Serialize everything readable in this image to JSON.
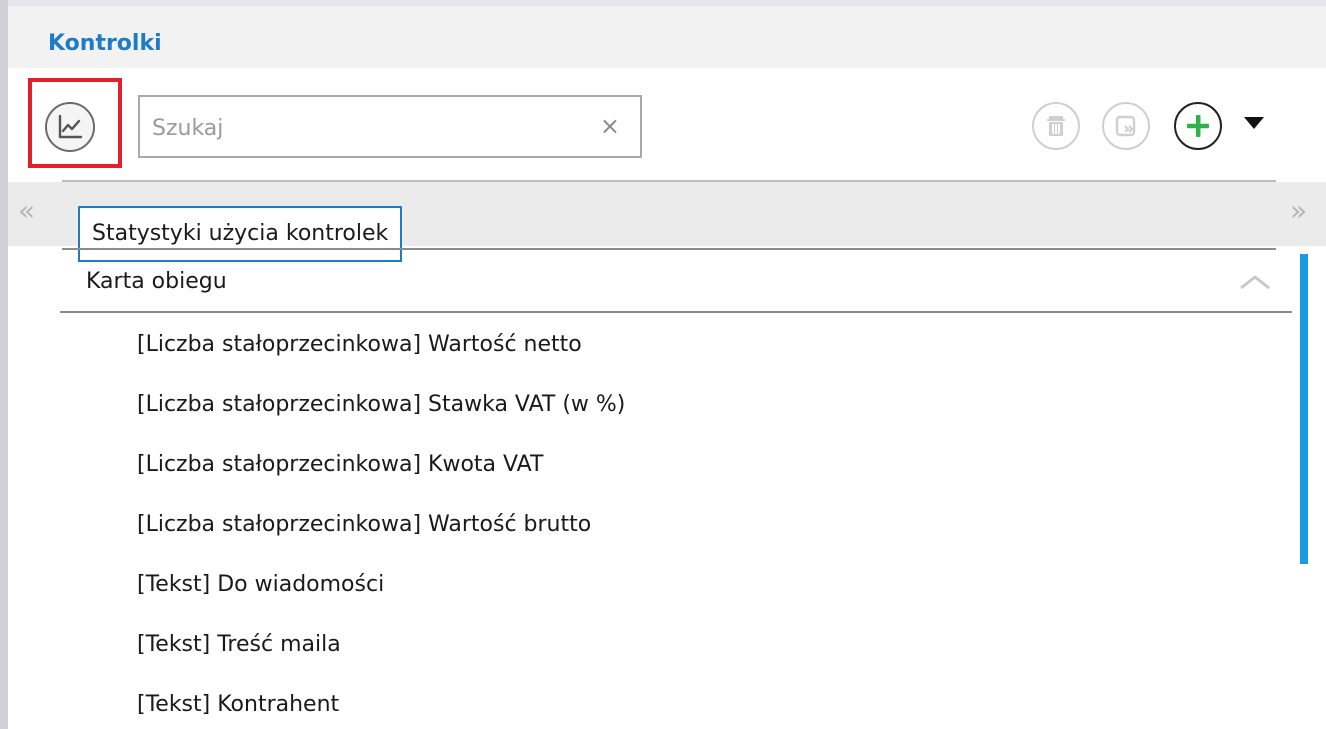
{
  "panel": {
    "title": "Kontrolki"
  },
  "toolbar": {
    "stats_button_icon": "line-chart-icon",
    "search_placeholder": "Szukaj",
    "search_value": "",
    "clear_label": "×",
    "delete_icon": "trash-icon",
    "copy_icon": "copy-forward-icon",
    "add_icon": "plus-icon",
    "dropdown_icon": "caret-down-icon"
  },
  "tabs": {
    "scroll_left": "«",
    "scroll_right": "»"
  },
  "tooltip": {
    "text": "Statystyki użycia kontrolek"
  },
  "group": {
    "title": "Karta obiegu",
    "collapse_icon": "chevron-up-icon"
  },
  "items": [
    "[Liczba stałoprzecinkowa] Wartość netto",
    "[Liczba stałoprzecinkowa] Stawka VAT (w %)",
    "[Liczba stałoprzecinkowa] Kwota VAT",
    "[Liczba stałoprzecinkowa] Wartość brutto",
    "[Tekst] Do wiadomości",
    "[Tekst] Treść maila",
    "[Tekst] Kontrahent"
  ],
  "colors": {
    "accent": "#1e7bc6",
    "highlight": "#e1202a",
    "add_green": "#2db34a",
    "scrollbar": "#1a9be0"
  }
}
